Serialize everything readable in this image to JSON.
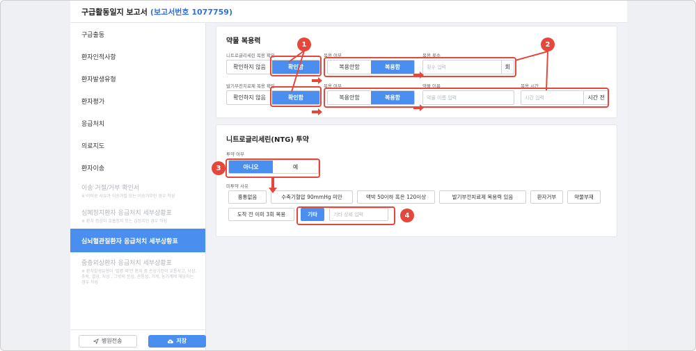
{
  "header": {
    "title": "구급활동일지 보고서",
    "report_no": "(보고서번호 1077759)"
  },
  "sidebar": {
    "items": [
      {
        "label": "구급출동"
      },
      {
        "label": "환자인적사항"
      },
      {
        "label": "환자발생유형"
      },
      {
        "label": "환자평가"
      },
      {
        "label": "응급처치"
      },
      {
        "label": "의료지도"
      },
      {
        "label": "환자이송"
      },
      {
        "label": "이송 거절/거부 확인서",
        "sub": "※ 이미송 사유가 이송거절 또는 이송거부인 경우 작성"
      },
      {
        "label": "심폐정지환자 응급처치 세부상황표",
        "sub": "※ 환자 증상이 호흡정지 또는 심정지인 경우 작성"
      },
      {
        "label": "심뇌혈관질환자 응급처치 세부상황표"
      },
      {
        "label": "중증외상환자 응급처치 세부상황표",
        "sub": "※ 환자발생유형이 '질병 외'인 환자 중 손상기전이 교통사고, 낙상, 추락, 열상, 자상 , 그밖의 둔상, 관통상, 기계, 농기계에 해당하는 경우 작성"
      }
    ],
    "send_label": "병원전송",
    "save_label": "저장"
  },
  "medication": {
    "title": "약물 복용력",
    "ntg_label": "니트로글리세린 복용 확인",
    "pde_label": "발기부전치료제 복용 확인",
    "not_confirmed": "확인하지 않음",
    "confirmed": "확인함",
    "taken_label": "복용 여부",
    "not_taken": "복용안함",
    "taken": "복용함",
    "count_label": "복용 횟수",
    "count_placeholder": "횟수 입력",
    "count_unit": "회",
    "name_label": "약물 이름",
    "name_placeholder": "약물 이름 입력",
    "time_label": "복용 시간",
    "time_placeholder": "시간 입력",
    "time_unit": "시간 전"
  },
  "ntg": {
    "title": "니트로글리세린(NTG) 투약",
    "admin_label": "투약 여부",
    "no": "아니오",
    "yes": "예",
    "reason_label": "미투약 사유",
    "reasons": [
      "흉통없음",
      "수축기혈압 90mmHg 미만",
      "맥박 50이하 혹은 120이상",
      "발기부전치료제 복용력 있음",
      "환자거부",
      "약물부재",
      "도착 전 이미 3회 복용",
      "기타"
    ],
    "other_placeholder": "기타 상세 입력"
  },
  "callouts": [
    "1",
    "2",
    "3",
    "4"
  ],
  "colors": {
    "accent": "#4a8ef0",
    "annotation": "#e5473a",
    "title_blue": "#2f6fdf"
  },
  "icons": {
    "send": "paper-plane-icon",
    "save": "cloud-upload-icon"
  }
}
